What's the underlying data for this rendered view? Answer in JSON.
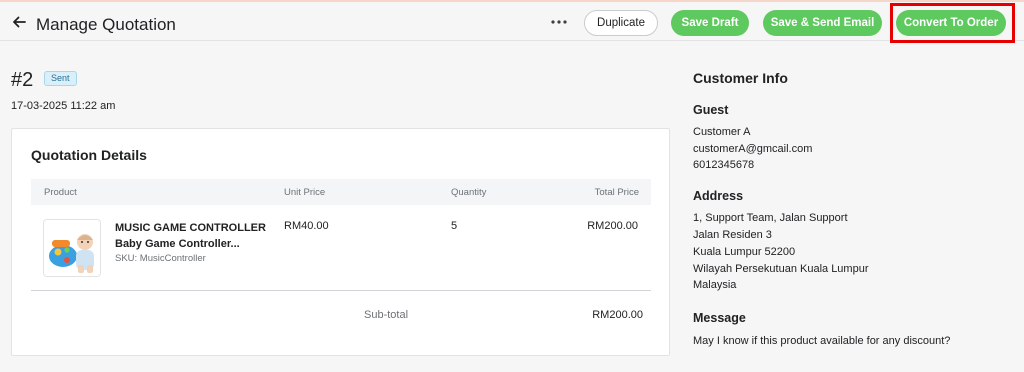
{
  "header": {
    "title": "Manage Quotation",
    "buttons": {
      "duplicate": "Duplicate",
      "save_draft": "Save Draft",
      "save_send": "Save & Send Email",
      "convert": "Convert To Order"
    }
  },
  "quotation": {
    "number": "#2",
    "status": "Sent",
    "date": "17-03-2025 11:22 am"
  },
  "details": {
    "title": "Quotation Details",
    "columns": [
      "Product",
      "Unit Price",
      "Quantity",
      "Total Price"
    ],
    "item": {
      "name_line1": "MUSIC GAME CONTROLLER",
      "name_line2": "Baby Game Controller...",
      "sku": "SKU: MusicController",
      "unit_price": "RM40.00",
      "quantity": "5",
      "total": "RM200.00"
    },
    "subtotal_label": "Sub-total",
    "subtotal_value": "RM200.00"
  },
  "customer": {
    "heading": "Customer Info",
    "type": "Guest",
    "name": "Customer A",
    "email": "customerA@gmcail.com",
    "phone": "6012345678",
    "address_heading": "Address",
    "address_lines": [
      "1, Support Team, Jalan Support",
      "Jalan Residen 3",
      "Kuala Lumpur 52200",
      "Wilayah Persekutuan Kuala Lumpur",
      "Malaysia"
    ],
    "message_heading": "Message",
    "message": "May I know if this product available for any discount?"
  },
  "colors": {
    "accent_green": "#5ec95e",
    "highlight_red": "#e60000",
    "badge_bg": "#d9f0fb"
  },
  "icons": {
    "back": "arrow-left-icon",
    "more": "more-horizontal-icon"
  }
}
